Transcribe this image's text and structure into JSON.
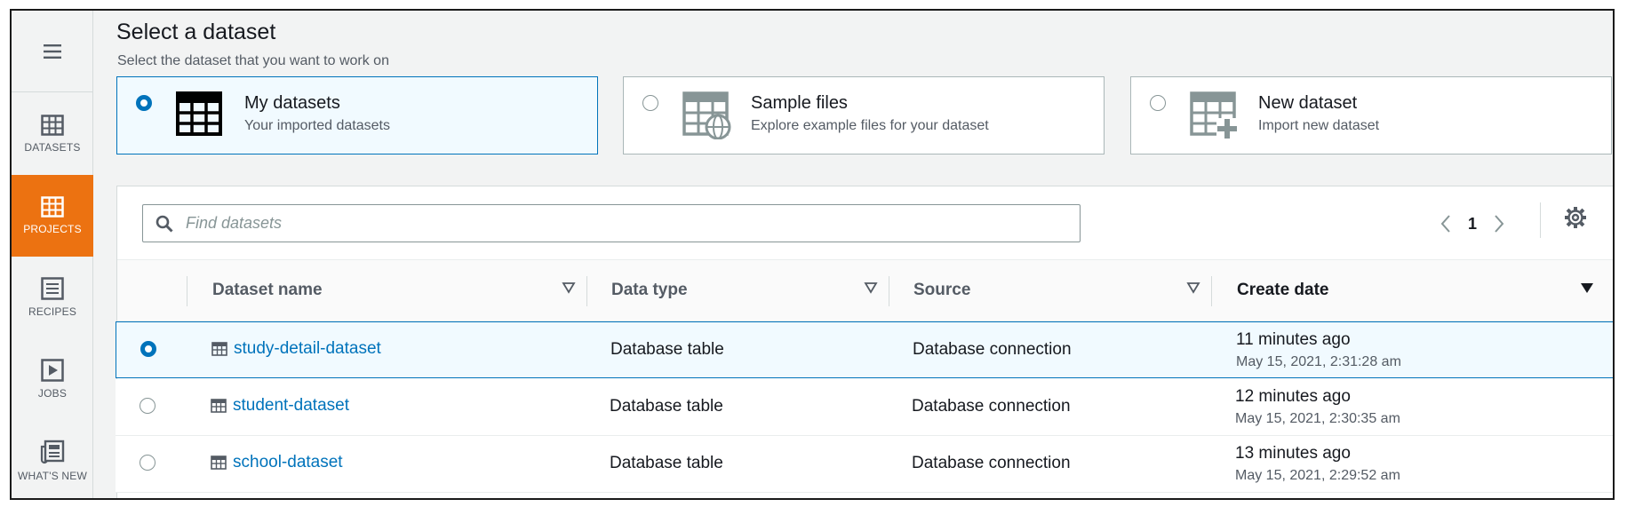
{
  "sidebar": {
    "menu_icon": "hamburger-menu-icon",
    "items": [
      {
        "label": "DATASETS",
        "icon": "datasets-grid-icon",
        "active": false
      },
      {
        "label": "PROJECTS",
        "icon": "projects-grid-icon",
        "active": true
      },
      {
        "label": "RECIPES",
        "icon": "recipes-list-icon",
        "active": false
      },
      {
        "label": "JOBS",
        "icon": "jobs-play-icon",
        "active": false
      },
      {
        "label": "WHAT'S NEW",
        "icon": "whats-new-newspaper-icon",
        "active": false
      }
    ]
  },
  "header": {
    "title": "Select a dataset",
    "subtitle": "Select the dataset that you want to work on"
  },
  "tiles": [
    {
      "name": "My datasets",
      "desc": "Your imported datasets",
      "selected": true,
      "icon": "table-icon"
    },
    {
      "name": "Sample files",
      "desc": "Explore example files for your dataset",
      "selected": false,
      "icon": "table-globe-icon"
    },
    {
      "name": "New dataset",
      "desc": "Import new dataset",
      "selected": false,
      "icon": "table-plus-icon"
    }
  ],
  "search": {
    "placeholder": "Find datasets",
    "value": ""
  },
  "pagination": {
    "current_page": "1"
  },
  "table": {
    "columns": [
      {
        "label": "Dataset name"
      },
      {
        "label": "Data type"
      },
      {
        "label": "Source"
      },
      {
        "label": "Create date",
        "sorted": "descending"
      }
    ],
    "rows": [
      {
        "name": "study-detail-dataset",
        "type": "Database table",
        "source": "Database connection",
        "created_relative": "11 minutes ago",
        "created_absolute": "May 15, 2021, 2:31:28 am",
        "selected": true
      },
      {
        "name": "student-dataset",
        "type": "Database table",
        "source": "Database connection",
        "created_relative": "12 minutes ago",
        "created_absolute": "May 15, 2021, 2:30:35 am",
        "selected": false
      },
      {
        "name": "school-dataset",
        "type": "Database table",
        "source": "Database connection",
        "created_relative": "13 minutes ago",
        "created_absolute": "May 15, 2021, 2:29:52 am",
        "selected": false
      }
    ]
  },
  "colors": {
    "accent_orange": "#ec7211",
    "link_blue": "#0073bb",
    "selected_bg": "#f1faff"
  }
}
